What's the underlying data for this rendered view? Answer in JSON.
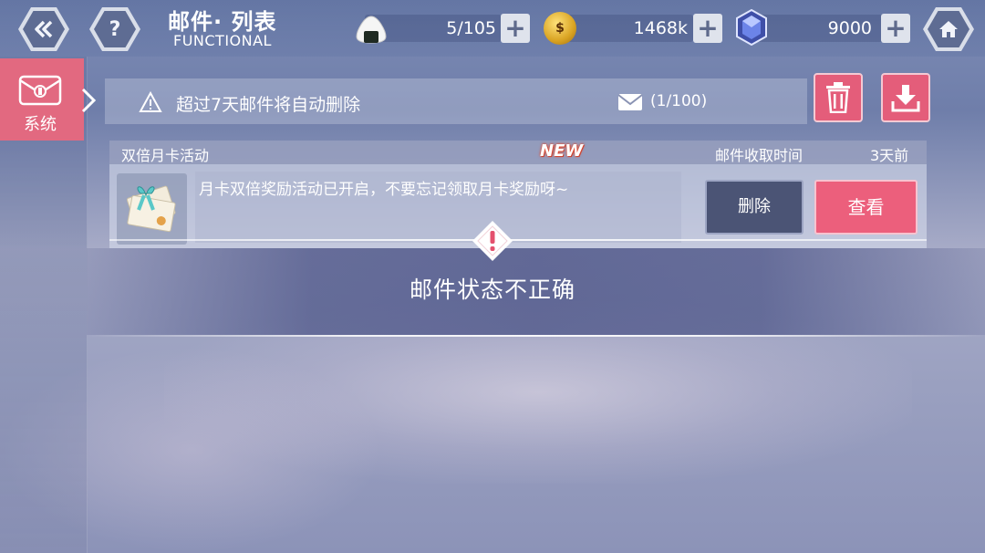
{
  "header": {
    "title": "邮件· 列表",
    "subtitle": "FUNCTIONAL",
    "back_icon": "double-chevron-left-icon",
    "help_label": "?",
    "home_icon": "home-icon"
  },
  "resources": {
    "stamina": {
      "icon": "onigiri-icon",
      "value": "5/105"
    },
    "coins": {
      "icon": "coin-icon",
      "value": "1468k",
      "coin_glyph": "$"
    },
    "gems": {
      "icon": "crystal-icon",
      "value": "9000"
    },
    "plus_label": "+"
  },
  "sidebar": {
    "tabs": [
      {
        "label": "系统",
        "icon": "system-mail-icon",
        "active": true
      }
    ]
  },
  "info": {
    "notice": "超过7天邮件将自动删除",
    "mail_count": "(1/100)"
  },
  "actions": {
    "delete_all_icon": "trash-icon",
    "collect_all_icon": "download-icon"
  },
  "mail_list": [
    {
      "title": "双倍月卡活动",
      "badge": "NEW",
      "received_label": "邮件收取时间",
      "received_time": "3天前",
      "message": "月卡双倍奖励活动已开启，不要忘记领取月卡奖励呀~",
      "thumbnail_icon": "gift-letter-icon",
      "delete_label": "删除",
      "view_label": "查看"
    }
  ],
  "toast": {
    "message": "邮件状态不正确",
    "icon": "warning-diamond-icon"
  },
  "colors": {
    "accent_pink": "#e45d7a",
    "dark_button": "#4b5475",
    "toast_bg": "#50588a"
  }
}
